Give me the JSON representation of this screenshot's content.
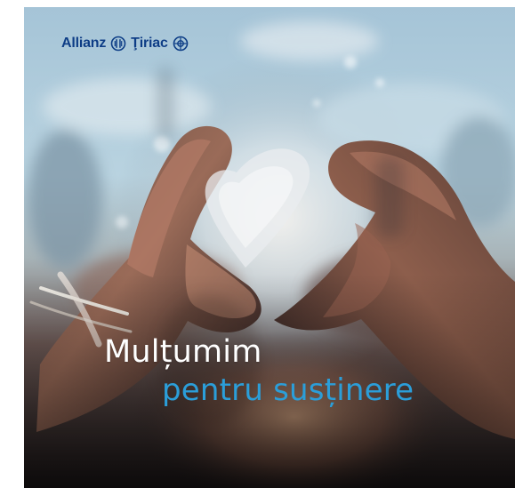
{
  "brand": {
    "left": "Allianz",
    "right": "Ţiriac",
    "color": "#0d3d86"
  },
  "headline": {
    "line1": "Mulțumim",
    "line2": "pentru susținere",
    "line1_color": "#ffffff",
    "line2_color": "#2b9ed9"
  },
  "icons": {
    "brand_mark_left": "allianz-eagle-icon",
    "brand_mark_right": "tiriac-ring-icon"
  }
}
